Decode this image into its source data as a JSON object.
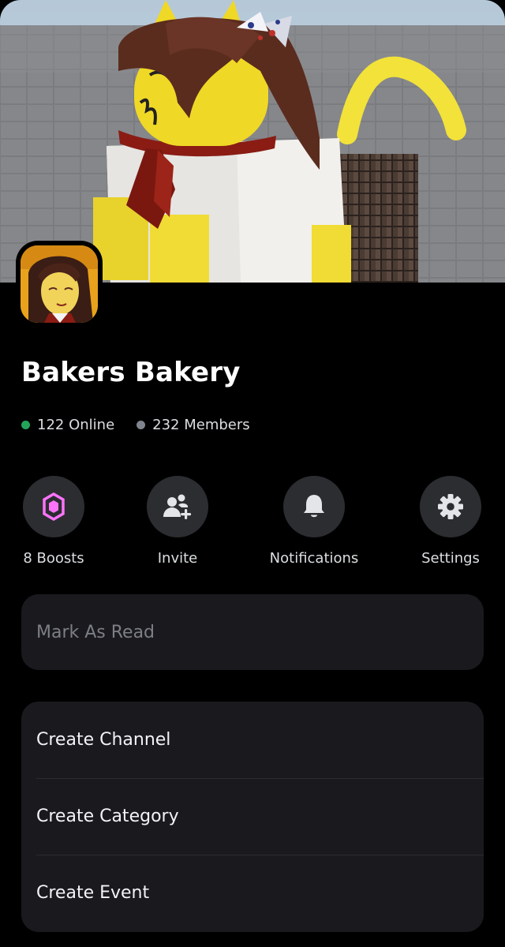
{
  "server": {
    "name": "Bakers Bakery",
    "online_count": "122 Online",
    "member_count": "232 Members",
    "online_color": "#23a55a",
    "member_color": "#80848e"
  },
  "actions": [
    {
      "label": "8 Boosts",
      "icon": "boost-gem-icon",
      "icon_color": "#ff73fa"
    },
    {
      "label": "Invite",
      "icon": "add-user-icon"
    },
    {
      "label": "Notifications",
      "icon": "bell-icon"
    },
    {
      "label": "Settings",
      "icon": "gear-icon"
    }
  ],
  "mark_read": {
    "label": "Mark As Read",
    "disabled": true
  },
  "create_menu": {
    "items": [
      {
        "label": "Create Channel"
      },
      {
        "label": "Create Category"
      },
      {
        "label": "Create Event"
      }
    ]
  },
  "colors": {
    "background": "#000000",
    "surface": "#1a1a1e",
    "action_circle": "#2b2d31",
    "text_primary": "#f2f3f5",
    "text_muted": "#7c7f86"
  }
}
